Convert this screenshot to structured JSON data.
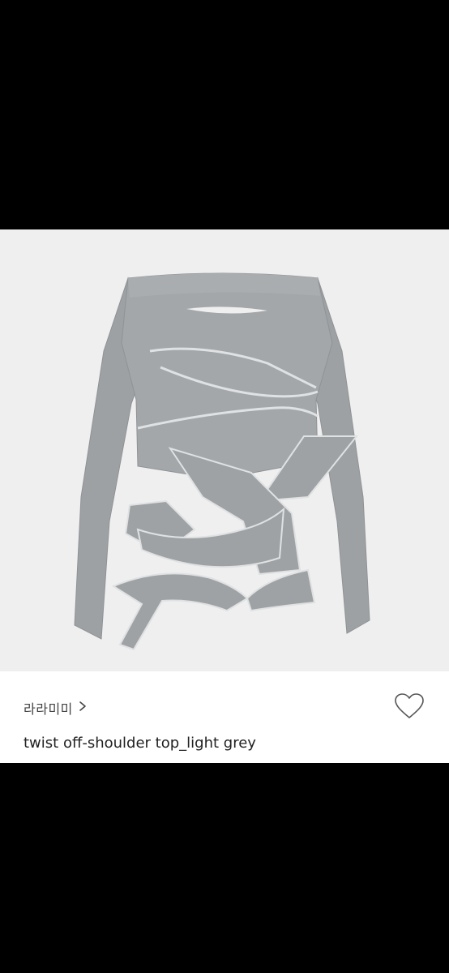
{
  "product": {
    "brand": "라라미미",
    "title": "twist off-shoulder top_light grey",
    "image_subject": "grey off-shoulder long-sleeve top with wrap ties"
  },
  "icons": {
    "brand_chevron": "chevron-right-icon",
    "wishlist": "heart-outline-icon"
  },
  "colors": {
    "background": "#000000",
    "image_bg": "#efefef",
    "garment": "#9ea2a5",
    "panel": "#ffffff"
  }
}
